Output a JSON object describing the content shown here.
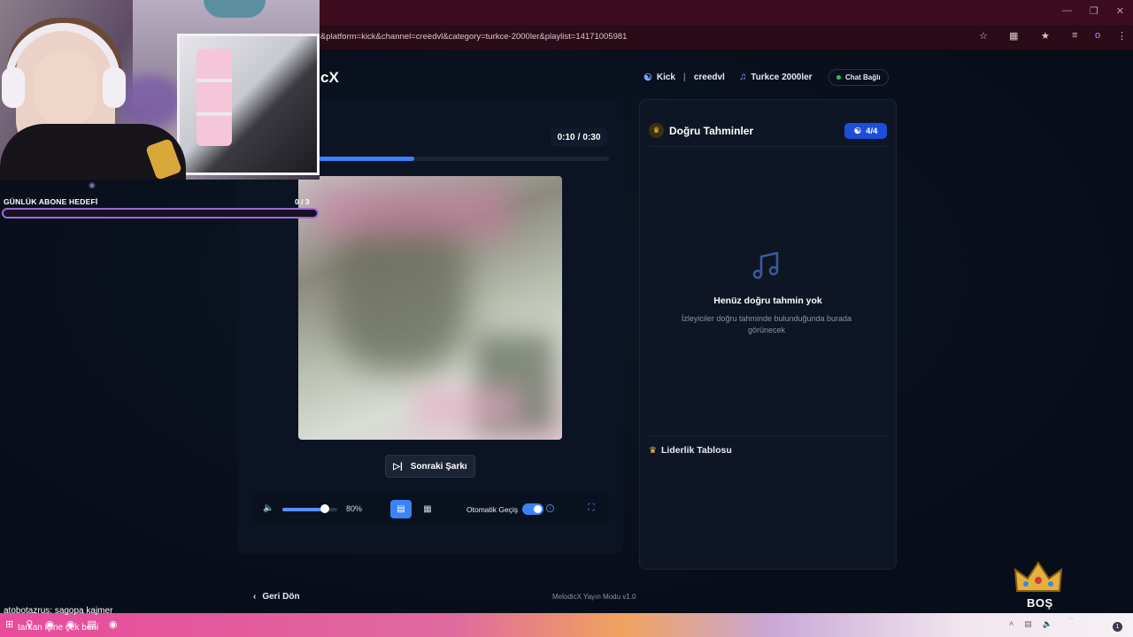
{
  "browser": {
    "url": "&platform=kick&channel=creedvl&category=turkce-2000ler&playlist=14171005981",
    "profile_initial": "o"
  },
  "app": {
    "logo_partial": "cX",
    "platform": "Kick",
    "channel": "creedvl",
    "category": "Turkce 2000ler",
    "chat_status": "Chat Bağlı",
    "status_color": "#22c55e",
    "accent_color": "#3b82f6"
  },
  "player": {
    "time_current": "0:10",
    "time_separator": "/",
    "time_total": "0:30",
    "progress": 0.33,
    "next_label": "Sonraki Şarkı",
    "volume_percent": 0.8,
    "volume_label": "80%",
    "auto_label": "Otomatik Geçiş",
    "auto_enabled": true
  },
  "guesses": {
    "title": "Doğru Tahminler",
    "count": "4/4",
    "empty_title": "Henüz doğru tahmin yok",
    "empty_sub": "İzleyiciler doğru tahminde bulunduğunda burada görünecek",
    "leaderboard_title": "Liderlik Tablosu"
  },
  "footer": {
    "back_label": "Geri Dön",
    "version": "MelodicX Yayın Modu v1.0"
  },
  "stream_overlay": {
    "goal_label": "GÜNLÜK ABONE HEDEFİ",
    "goal_current": "0",
    "goal_separator": "/",
    "goal_total": "3",
    "goal_progress": 0,
    "chat_line1": "atobotazrus: sagopa kajmer",
    "chat_line2": "tarkan içine çek beni",
    "badge_label": "BOŞ",
    "notification_count": "1"
  }
}
